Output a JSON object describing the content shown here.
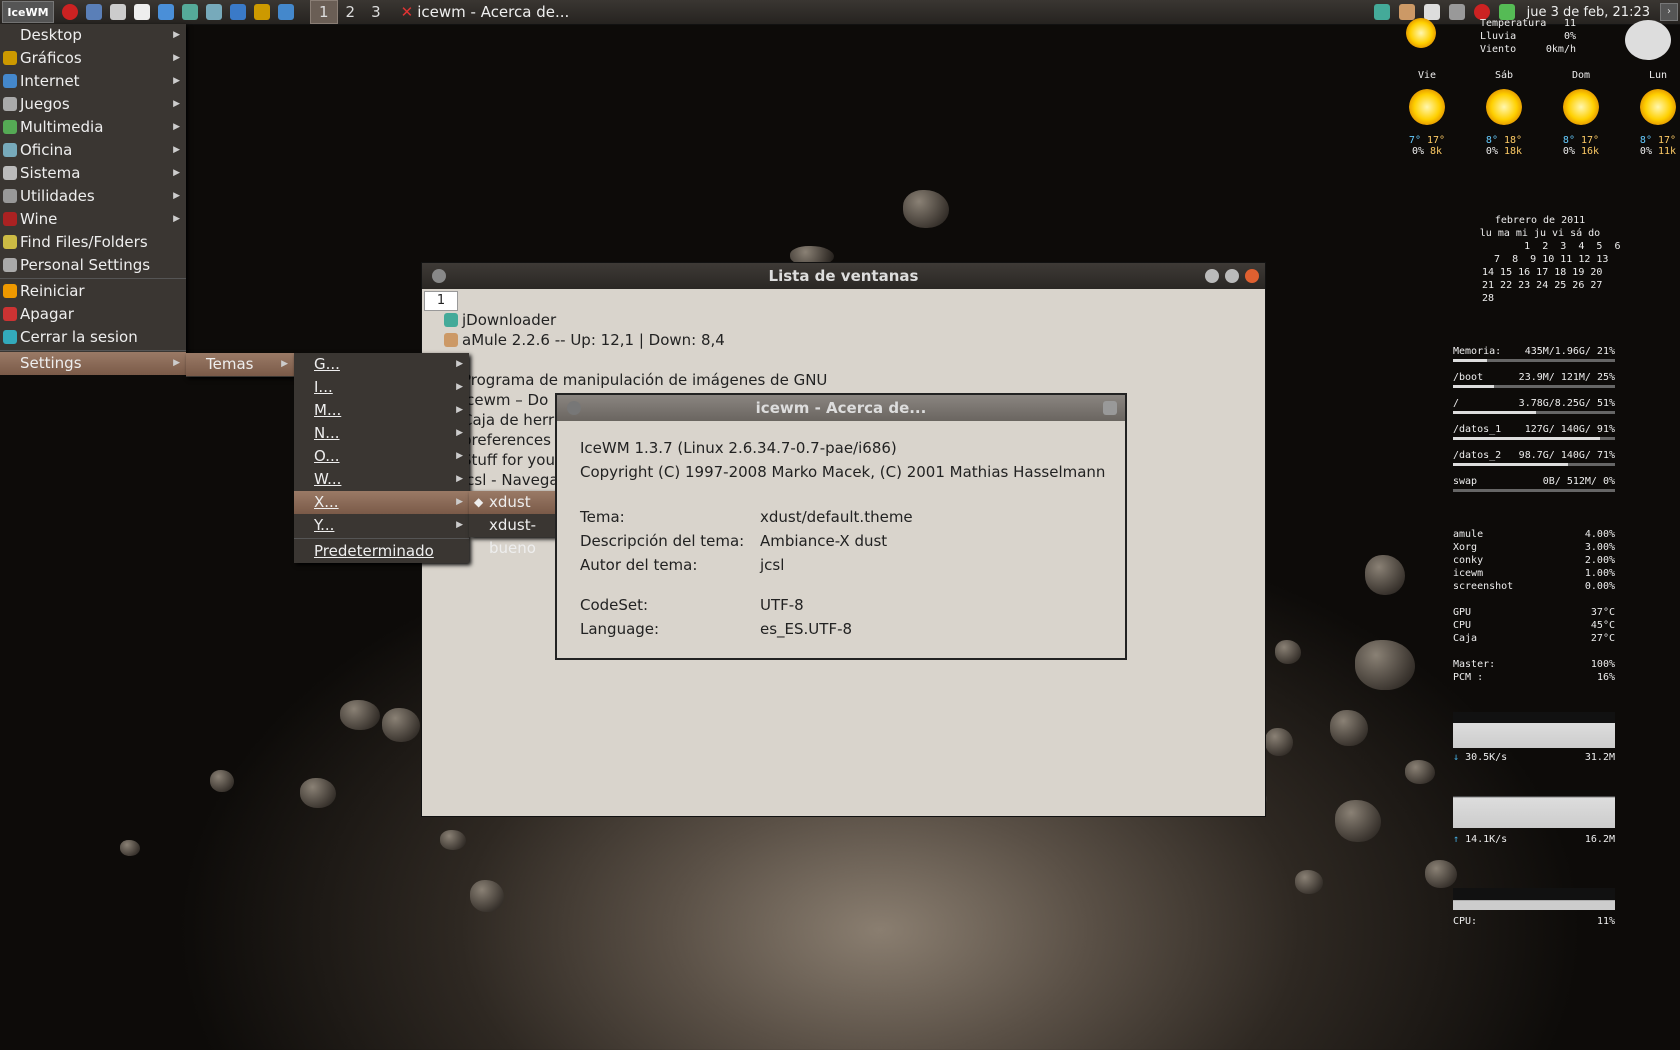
{
  "taskbar": {
    "logo": "IceWM",
    "workspaces": [
      "1",
      "2",
      "3"
    ],
    "active_workspace": "1",
    "task_title": "icewm - Acerca de...",
    "clock": "jue  3 de feb, 21:23"
  },
  "start_menu": {
    "items": [
      {
        "label": "Desktop",
        "icon": "desktop-icon"
      },
      {
        "label": "Gráficos",
        "icon": "palette-icon"
      },
      {
        "label": "Internet",
        "icon": "globe-icon"
      },
      {
        "label": "Juegos",
        "icon": "gamepad-icon"
      },
      {
        "label": "Multimedia",
        "icon": "music-icon"
      },
      {
        "label": "Oficina",
        "icon": "office-icon"
      },
      {
        "label": "Sistema",
        "icon": "gear-icon"
      },
      {
        "label": "Utilidades",
        "icon": "tools-icon"
      },
      {
        "label": "Wine",
        "icon": "wine-icon"
      },
      {
        "label": "Find Files/Folders",
        "icon": "search-icon"
      },
      {
        "label": "Personal Settings",
        "icon": "settings-icon"
      },
      {
        "label": "Reiniciar",
        "icon": "restart-icon"
      },
      {
        "label": "Apagar",
        "icon": "power-icon"
      },
      {
        "label": "Cerrar la sesion",
        "icon": "logout-icon"
      },
      {
        "label": "Settings",
        "icon": ""
      }
    ],
    "temas_label": "Temas",
    "theme_letters": [
      "G...",
      "I...",
      "M...",
      "N...",
      "O...",
      "W...",
      "X...",
      "Y...",
      "Predeterminado"
    ],
    "x_themes": [
      "xdust",
      "xdust-bueno"
    ],
    "selected_glyph": "◆"
  },
  "window_list": {
    "title": "Lista de ventanas",
    "workspace": "1",
    "rows": [
      "jDownloader",
      "aMule 2.2.6 -- Up: 12,1 | Down: 8,4",
      "Programa de manipulación de imágenes de GNU",
      "icewm – Do",
      "Caja de herr",
      "preferences",
      "Stuff for you",
      "jcsl - Navega"
    ]
  },
  "about": {
    "title": "icewm - Acerca de...",
    "version": "IceWM 1.3.7 (Linux 2.6.34.7-0.7-pae/i686)",
    "copyright": "Copyright (C) 1997-2008 Marko Macek, (C) 2001 Mathias Hasselmann",
    "fields": [
      {
        "k": "Tema:",
        "v": "xdust/default.theme"
      },
      {
        "k": "Descripción del tema:",
        "v": "Ambiance-X dust"
      },
      {
        "k": "Autor del tema:",
        "v": "jcsl"
      },
      {
        "k": "CodeSet:",
        "v": "UTF-8"
      },
      {
        "k": "Language:",
        "v": "es_ES.UTF-8"
      }
    ]
  },
  "conky": {
    "weather_now": [
      [
        "Temperatura",
        "11"
      ],
      [
        "Lluvia",
        "0%"
      ],
      [
        "Viento",
        "0km/h"
      ]
    ],
    "forecast": [
      {
        "day": "Vie",
        "lo": "7°",
        "hi": "17°",
        "rain": "0%",
        "wind": "8k"
      },
      {
        "day": "Sáb",
        "lo": "8°",
        "hi": "18°",
        "rain": "0%",
        "wind": "18k"
      },
      {
        "day": "Dom",
        "lo": "8°",
        "hi": "17°",
        "rain": "0%",
        "wind": "16k"
      },
      {
        "day": "Lun",
        "lo": "8°",
        "hi": "17°",
        "rain": "0%",
        "wind": "11k"
      }
    ],
    "calendar_title": "febrero de 2011",
    "calendar_header": "lu ma mi ju vi sá do",
    "calendar_rows": [
      "       1  2  3  4  5  6",
      "  7  8  9 10 11 12 13",
      "14 15 16 17 18 19 20",
      "21 22 23 24 25 26 27",
      "28"
    ],
    "disks": [
      {
        "label": "Memoria:",
        "value": "435M/1.96G/ 21%",
        "pct": 0.21
      },
      {
        "label": "/boot",
        "value": "23.9M/ 121M/ 25%",
        "pct": 0.25
      },
      {
        "label": "/",
        "value": "3.78G/8.25G/ 51%",
        "pct": 0.51
      },
      {
        "label": "/datos_1",
        "value": "127G/ 140G/ 91%",
        "pct": 0.91
      },
      {
        "label": "/datos_2",
        "value": "98.7G/ 140G/ 71%",
        "pct": 0.71
      },
      {
        "label": "swap",
        "value": "0B/ 512M/  0%",
        "pct": 0
      }
    ],
    "procs": [
      [
        "amule",
        "4.00%"
      ],
      [
        "Xorg",
        "3.00%"
      ],
      [
        "conky",
        "2.00%"
      ],
      [
        "icewm",
        "1.00%"
      ],
      [
        "screenshot",
        "0.00%"
      ]
    ],
    "temps": [
      [
        "GPU",
        "37°C"
      ],
      [
        "CPU",
        "45°C"
      ],
      [
        "Caja",
        "27°C"
      ]
    ],
    "volume": [
      [
        "Master:",
        "100%"
      ],
      [
        "PCM   :",
        "16%"
      ]
    ],
    "down": {
      "rate": "30.5K/s",
      "total": "31.2M"
    },
    "up": {
      "rate": "14.1K/s",
      "total": "16.2M"
    },
    "cpu": {
      "label": "CPU:",
      "value": "11%"
    }
  }
}
